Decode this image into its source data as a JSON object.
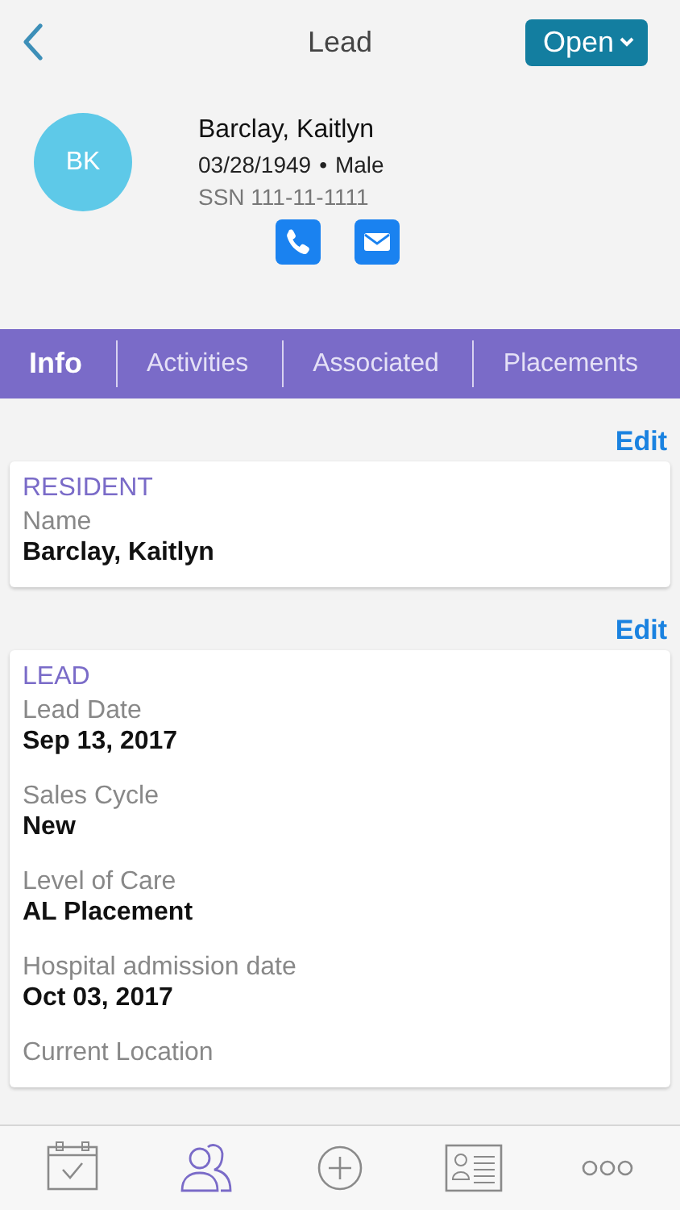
{
  "header": {
    "title": "Lead",
    "status_button": "Open"
  },
  "profile": {
    "initials": "BK",
    "name": "Barclay, Kaitlyn",
    "birth_date": "03/28/1949",
    "separator": "•",
    "gender": "Male",
    "ssn": "SSN 111-11-1111"
  },
  "tabs": [
    {
      "label": "Info",
      "selected": true
    },
    {
      "label": "Activities",
      "selected": false
    },
    {
      "label": "Associated",
      "selected": false
    },
    {
      "label": "Placements",
      "selected": false
    }
  ],
  "sections": [
    {
      "edit": "Edit",
      "title": "RESIDENT",
      "fields": [
        {
          "label": "Name",
          "value": "Barclay, Kaitlyn"
        }
      ]
    },
    {
      "edit": "Edit",
      "title": "LEAD",
      "fields": [
        {
          "label": "Lead Date",
          "value": "Sep 13, 2017"
        },
        {
          "label": "Sales Cycle",
          "value": "New"
        },
        {
          "label": "Level of Care",
          "value": "AL Placement"
        },
        {
          "label": "Hospital admission date",
          "value": "Oct 03, 2017"
        },
        {
          "label": "Current Location"
        }
      ]
    }
  ],
  "tab_bar": [
    {
      "kind": "calendar",
      "selected": false
    },
    {
      "kind": "people",
      "selected": true
    },
    {
      "kind": "add",
      "selected": false
    },
    {
      "kind": "contact",
      "selected": false
    },
    {
      "kind": "more",
      "selected": false
    }
  ]
}
